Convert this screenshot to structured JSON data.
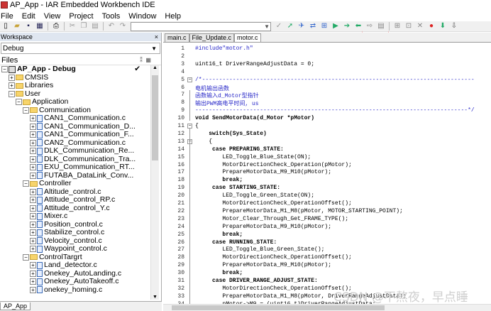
{
  "window": {
    "title": "AP_App - IAR Embedded Workbench IDE"
  },
  "menu": [
    "File",
    "Edit",
    "View",
    "Project",
    "Tools",
    "Window",
    "Help"
  ],
  "workspace": {
    "header": "Workspace",
    "close": "×",
    "config": "Debug",
    "files_label": "Files",
    "tab": "AP_App",
    "tree": [
      {
        "level": 0,
        "type": "project",
        "exp": "−",
        "label": "AP_App - Debug",
        "bold": true,
        "check": "✔"
      },
      {
        "level": 1,
        "type": "folder",
        "exp": "+",
        "label": "CMSIS"
      },
      {
        "level": 1,
        "type": "folder",
        "exp": "+",
        "label": "Libraries"
      },
      {
        "level": 1,
        "type": "folder",
        "exp": "−",
        "label": "User"
      },
      {
        "level": 2,
        "type": "folder",
        "exp": "−",
        "label": "Application"
      },
      {
        "level": 3,
        "type": "folder",
        "exp": "−",
        "label": "Communication"
      },
      {
        "level": 4,
        "type": "file",
        "exp": "+",
        "label": "CAN1_Communication.c"
      },
      {
        "level": 4,
        "type": "file",
        "exp": "+",
        "label": "CAN1_Communication_D..."
      },
      {
        "level": 4,
        "type": "file",
        "exp": "+",
        "label": "CAN1_Communication_F..."
      },
      {
        "level": 4,
        "type": "file",
        "exp": "+",
        "label": "CAN2_Communication.c"
      },
      {
        "level": 4,
        "type": "file",
        "exp": "+",
        "label": "DLK_Communication_Re..."
      },
      {
        "level": 4,
        "type": "file",
        "exp": "+",
        "label": "DLK_Communication_Tra..."
      },
      {
        "level": 4,
        "type": "file",
        "exp": "+",
        "label": "EXU_Communication_RT..."
      },
      {
        "level": 4,
        "type": "file",
        "exp": "+",
        "label": "FUTABA_DataLink_Conv..."
      },
      {
        "level": 3,
        "type": "folder",
        "exp": "−",
        "label": "Controller"
      },
      {
        "level": 4,
        "type": "file",
        "exp": "+",
        "label": "Altitude_control.c"
      },
      {
        "level": 4,
        "type": "file",
        "exp": "+",
        "label": "Attitude_control_RP.c"
      },
      {
        "level": 4,
        "type": "file",
        "exp": "+",
        "label": "Attitude_control_Y.c"
      },
      {
        "level": 4,
        "type": "file",
        "exp": "+",
        "label": "Mixer.c"
      },
      {
        "level": 4,
        "type": "file",
        "exp": "+",
        "label": "Position_control.c"
      },
      {
        "level": 4,
        "type": "file",
        "exp": "+",
        "label": "Stabilize_control.c"
      },
      {
        "level": 4,
        "type": "file",
        "exp": "+",
        "label": "Velocity_control.c"
      },
      {
        "level": 4,
        "type": "file",
        "exp": "+",
        "label": "Waypoint_control.c"
      },
      {
        "level": 3,
        "type": "folder",
        "exp": "−",
        "label": "ControlTargrt"
      },
      {
        "level": 4,
        "type": "file",
        "exp": "+",
        "label": "Land_detector.c"
      },
      {
        "level": 4,
        "type": "file",
        "exp": "+",
        "label": "Onekey_AutoLanding.c"
      },
      {
        "level": 4,
        "type": "file",
        "exp": "+",
        "label": "Onekey_AutoTakeoff.c"
      },
      {
        "level": 4,
        "type": "file",
        "exp": "+",
        "label": "onekey_homing.c"
      }
    ]
  },
  "editor": {
    "tabs": [
      "main.c",
      "File_Update.c",
      "motor.c"
    ],
    "active_tab": 2,
    "lines": [
      {
        "n": "1",
        "text": "#include\"motor.h\"",
        "cls": "pp"
      },
      {
        "n": "2",
        "text": ""
      },
      {
        "n": "3",
        "text": "uint16_t DriverRangeAdjustData = 0;"
      },
      {
        "n": "4",
        "text": ""
      },
      {
        "n": "5",
        "text": "/*--------------------------------------------------------------------------------",
        "cls": "cm",
        "fold": "−"
      },
      {
        "n": "6",
        "text": "电机输出函数",
        "cls": "cm"
      },
      {
        "n": "7",
        "text": "函数输入d_Motor型指针",
        "cls": "cm"
      },
      {
        "n": "8",
        "text": "输出PWM高电平时间, us",
        "cls": "cm"
      },
      {
        "n": "9",
        "text": "--------------------------------------------------------------------------------*/",
        "cls": "cm"
      },
      {
        "n": "10",
        "text": "void SendMotorData(d_Motor *pMotor)"
      },
      {
        "n": "11",
        "text": "{",
        "fold": "−"
      },
      {
        "n": "12",
        "text": "    switch(Sys_State)",
        "bold": "switch"
      },
      {
        "n": "13",
        "text": "    {",
        "fold": "−"
      },
      {
        "n": "14",
        "text": "     case PREPARING_STATE:"
      },
      {
        "n": "15",
        "text": "        LED_Toggle_Blue_State(ON);"
      },
      {
        "n": "16",
        "text": "        MotorDirectionCheck_Operation(pMotor);"
      },
      {
        "n": "17",
        "text": "        PrepareMotorData_M9_M10(pMotor);"
      },
      {
        "n": "18",
        "text": "        break;"
      },
      {
        "n": "19",
        "text": "     case STARTING_STATE:"
      },
      {
        "n": "20",
        "text": "        LED_Toggle_Green_State(ON);"
      },
      {
        "n": "21",
        "text": "        MotorDirectionCheck_OperationOffset();"
      },
      {
        "n": "22",
        "text": "        PrepareMotorData_M1_M8(pMotor, MOTOR_STARTING_POINT);"
      },
      {
        "n": "23",
        "text": "        Motor_Clear_Through_Get_FRAME_TYPE();"
      },
      {
        "n": "24",
        "text": "        PrepareMotorData_M9_M10(pMotor);"
      },
      {
        "n": "25",
        "text": "        break;"
      },
      {
        "n": "26",
        "text": "     case RUNNING_STATE:"
      },
      {
        "n": "27",
        "text": "        LED_Toggle_Blue_Green_State();"
      },
      {
        "n": "28",
        "text": "        MotorDirectionCheck_OperationOffset();"
      },
      {
        "n": "29",
        "text": "        PrepareMotorData_M9_M10(pMotor);"
      },
      {
        "n": "30",
        "text": "        break;"
      },
      {
        "n": "31",
        "text": "     case DRIVER_RANGE_ADJUST_STATE:"
      },
      {
        "n": "32",
        "text": "        MotorDirectionCheck_OperationOffset();"
      },
      {
        "n": "33",
        "text": "        PrepareMotorData_M1_M8(pMotor, DriverRangeAdjustData);"
      },
      {
        "n": "34",
        "text": "        pMotor->M9 = (uint16_t)DriverRangeAdjustData;"
      }
    ]
  },
  "watermark": "CSDN @不熬夜，早点睡"
}
